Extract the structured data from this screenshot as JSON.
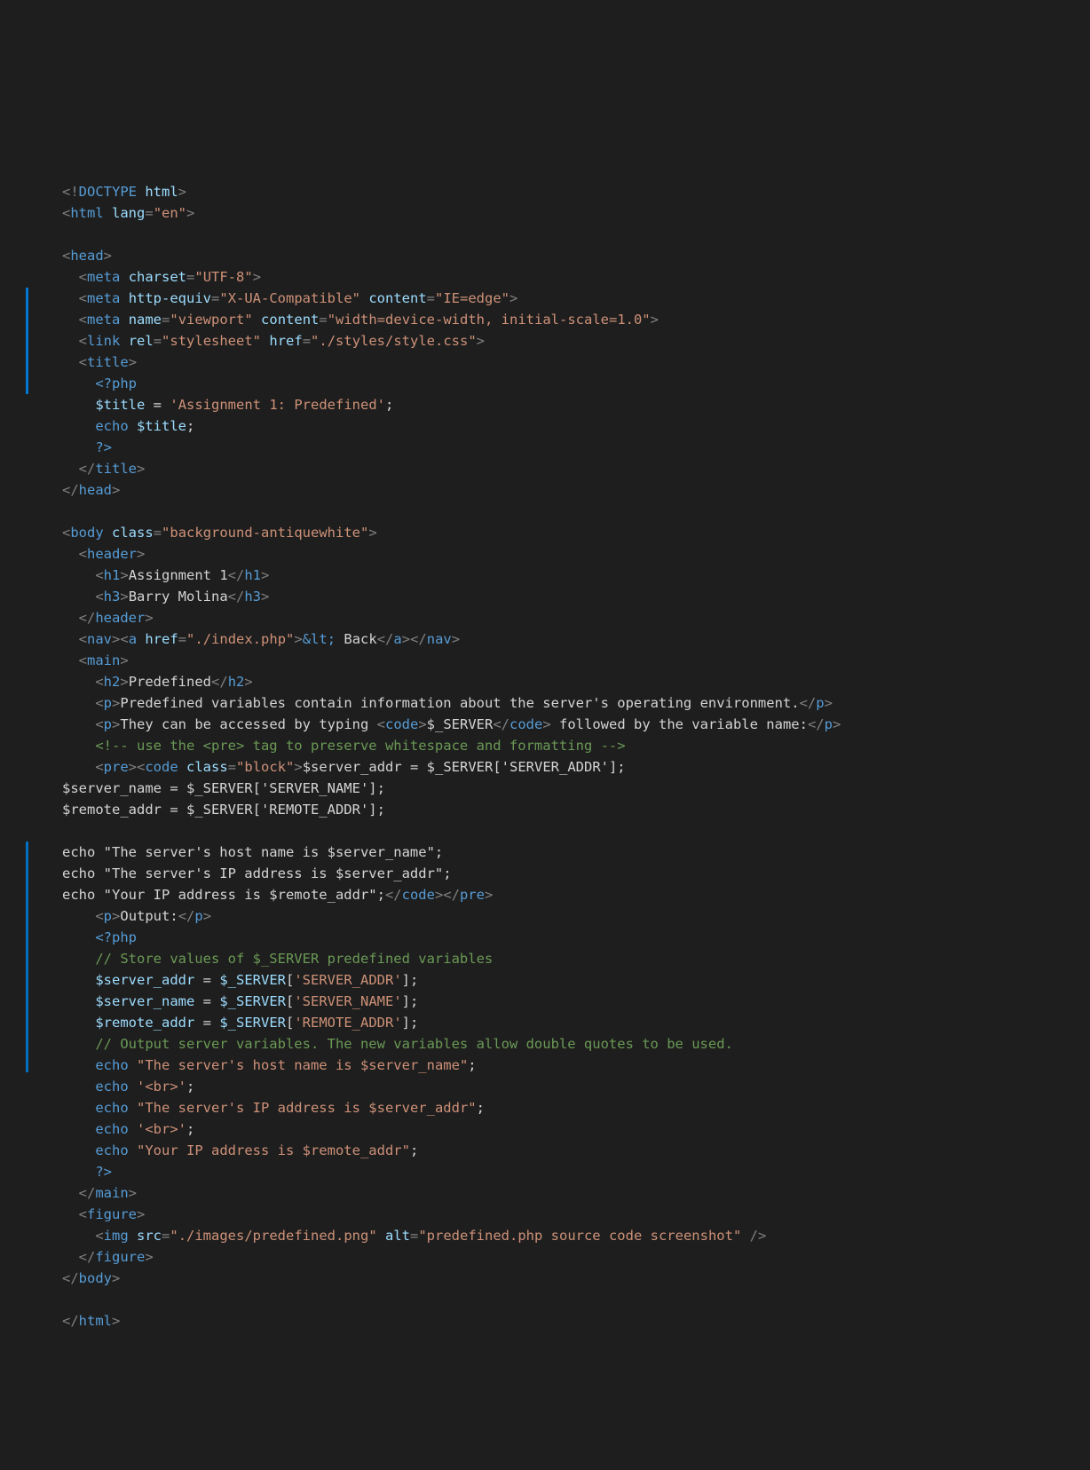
{
  "lines": [
    [
      [
        "pun",
        "<!"
      ],
      [
        "tag",
        "DOCTYPE"
      ],
      [
        "txt",
        " "
      ],
      [
        "attr",
        "html"
      ],
      [
        "pun",
        ">"
      ]
    ],
    [
      [
        "pun",
        "<"
      ],
      [
        "tag",
        "html"
      ],
      [
        "txt",
        " "
      ],
      [
        "attr",
        "lang"
      ],
      [
        "pun",
        "="
      ],
      [
        "str",
        "\"en\""
      ],
      [
        "pun",
        ">"
      ]
    ],
    [],
    [
      [
        "pun",
        "<"
      ],
      [
        "tag",
        "head"
      ],
      [
        "pun",
        ">"
      ]
    ],
    [
      [
        "txt",
        "  "
      ],
      [
        "pun",
        "<"
      ],
      [
        "tag",
        "meta"
      ],
      [
        "txt",
        " "
      ],
      [
        "attr",
        "charset"
      ],
      [
        "pun",
        "="
      ],
      [
        "str",
        "\"UTF-8\""
      ],
      [
        "pun",
        ">"
      ]
    ],
    [
      [
        "txt",
        "  "
      ],
      [
        "pun",
        "<"
      ],
      [
        "tag",
        "meta"
      ],
      [
        "txt",
        " "
      ],
      [
        "attr",
        "http-equiv"
      ],
      [
        "pun",
        "="
      ],
      [
        "str",
        "\"X-UA-Compatible\""
      ],
      [
        "txt",
        " "
      ],
      [
        "attr",
        "content"
      ],
      [
        "pun",
        "="
      ],
      [
        "str",
        "\"IE=edge\""
      ],
      [
        "pun",
        ">"
      ]
    ],
    [
      [
        "txt",
        "  "
      ],
      [
        "pun",
        "<"
      ],
      [
        "tag",
        "meta"
      ],
      [
        "txt",
        " "
      ],
      [
        "attr",
        "name"
      ],
      [
        "pun",
        "="
      ],
      [
        "str",
        "\"viewport\""
      ],
      [
        "txt",
        " "
      ],
      [
        "attr",
        "content"
      ],
      [
        "pun",
        "="
      ],
      [
        "str",
        "\"width=device-width, initial-scale=1.0\""
      ],
      [
        "pun",
        ">"
      ]
    ],
    [
      [
        "txt",
        "  "
      ],
      [
        "pun",
        "<"
      ],
      [
        "tag",
        "link"
      ],
      [
        "txt",
        " "
      ],
      [
        "attr",
        "rel"
      ],
      [
        "pun",
        "="
      ],
      [
        "str",
        "\"stylesheet\""
      ],
      [
        "txt",
        " "
      ],
      [
        "attr",
        "href"
      ],
      [
        "pun",
        "="
      ],
      [
        "str",
        "\"./styles/style.css\""
      ],
      [
        "pun",
        ">"
      ]
    ],
    [
      [
        "txt",
        "  "
      ],
      [
        "pun",
        "<"
      ],
      [
        "tag",
        "title"
      ],
      [
        "pun",
        ">"
      ]
    ],
    [
      [
        "txt",
        "    "
      ],
      [
        "php",
        "<?php"
      ]
    ],
    [
      [
        "txt",
        "    "
      ],
      [
        "var",
        "$title"
      ],
      [
        "txt",
        " "
      ],
      [
        "op",
        "="
      ],
      [
        "txt",
        " "
      ],
      [
        "str",
        "'Assignment 1: Predefined'"
      ],
      [
        "txt",
        ";"
      ]
    ],
    [
      [
        "txt",
        "    "
      ],
      [
        "kw",
        "echo"
      ],
      [
        "txt",
        " "
      ],
      [
        "var",
        "$title"
      ],
      [
        "txt",
        ";"
      ]
    ],
    [
      [
        "txt",
        "    "
      ],
      [
        "php",
        "?>"
      ]
    ],
    [
      [
        "txt",
        "  "
      ],
      [
        "pun",
        "</"
      ],
      [
        "tag",
        "title"
      ],
      [
        "pun",
        ">"
      ]
    ],
    [
      [
        "pun",
        "</"
      ],
      [
        "tag",
        "head"
      ],
      [
        "pun",
        ">"
      ]
    ],
    [],
    [
      [
        "pun",
        "<"
      ],
      [
        "tag",
        "body"
      ],
      [
        "txt",
        " "
      ],
      [
        "attr",
        "class"
      ],
      [
        "pun",
        "="
      ],
      [
        "str",
        "\"background-antiquewhite\""
      ],
      [
        "pun",
        ">"
      ]
    ],
    [
      [
        "txt",
        "  "
      ],
      [
        "pun",
        "<"
      ],
      [
        "tag",
        "header"
      ],
      [
        "pun",
        ">"
      ]
    ],
    [
      [
        "txt",
        "    "
      ],
      [
        "pun",
        "<"
      ],
      [
        "tag",
        "h1"
      ],
      [
        "pun",
        ">"
      ],
      [
        "txt",
        "Assignment 1"
      ],
      [
        "pun",
        "</"
      ],
      [
        "tag",
        "h1"
      ],
      [
        "pun",
        ">"
      ]
    ],
    [
      [
        "txt",
        "    "
      ],
      [
        "pun",
        "<"
      ],
      [
        "tag",
        "h3"
      ],
      [
        "pun",
        ">"
      ],
      [
        "txt",
        "Barry Molina"
      ],
      [
        "pun",
        "</"
      ],
      [
        "tag",
        "h3"
      ],
      [
        "pun",
        ">"
      ]
    ],
    [
      [
        "txt",
        "  "
      ],
      [
        "pun",
        "</"
      ],
      [
        "tag",
        "header"
      ],
      [
        "pun",
        ">"
      ]
    ],
    [
      [
        "txt",
        "  "
      ],
      [
        "pun",
        "<"
      ],
      [
        "tag",
        "nav"
      ],
      [
        "pun",
        "><"
      ],
      [
        "tag",
        "a"
      ],
      [
        "txt",
        " "
      ],
      [
        "attr",
        "href"
      ],
      [
        "pun",
        "="
      ],
      [
        "str",
        "\"./index.php\""
      ],
      [
        "pun",
        ">"
      ],
      [
        "tag",
        "&lt;"
      ],
      [
        "txt",
        " Back"
      ],
      [
        "pun",
        "</"
      ],
      [
        "tag",
        "a"
      ],
      [
        "pun",
        "></"
      ],
      [
        "tag",
        "nav"
      ],
      [
        "pun",
        ">"
      ]
    ],
    [
      [
        "txt",
        "  "
      ],
      [
        "pun",
        "<"
      ],
      [
        "tag",
        "main"
      ],
      [
        "pun",
        ">"
      ]
    ],
    [
      [
        "txt",
        "    "
      ],
      [
        "pun",
        "<"
      ],
      [
        "tag",
        "h2"
      ],
      [
        "pun",
        ">"
      ],
      [
        "txt",
        "Predefined"
      ],
      [
        "pun",
        "</"
      ],
      [
        "tag",
        "h2"
      ],
      [
        "pun",
        ">"
      ]
    ],
    [
      [
        "txt",
        "    "
      ],
      [
        "pun",
        "<"
      ],
      [
        "tag",
        "p"
      ],
      [
        "pun",
        ">"
      ],
      [
        "txt",
        "Predefined variables contain information about the server's operating environment."
      ],
      [
        "pun",
        "</"
      ],
      [
        "tag",
        "p"
      ],
      [
        "pun",
        ">"
      ]
    ],
    [
      [
        "txt",
        "    "
      ],
      [
        "pun",
        "<"
      ],
      [
        "tag",
        "p"
      ],
      [
        "pun",
        ">"
      ],
      [
        "txt",
        "They can be accessed by typing "
      ],
      [
        "pun",
        "<"
      ],
      [
        "tag",
        "code"
      ],
      [
        "pun",
        ">"
      ],
      [
        "txt",
        "$_SERVER"
      ],
      [
        "pun",
        "</"
      ],
      [
        "tag",
        "code"
      ],
      [
        "pun",
        ">"
      ],
      [
        "txt",
        " followed by the variable name:"
      ],
      [
        "pun",
        "</"
      ],
      [
        "tag",
        "p"
      ],
      [
        "pun",
        ">"
      ]
    ],
    [
      [
        "txt",
        "    "
      ],
      [
        "cmt",
        "<!-- use the <pre> tag to preserve whitespace and formatting -->"
      ]
    ],
    [
      [
        "txt",
        "    "
      ],
      [
        "pun",
        "<"
      ],
      [
        "tag",
        "pre"
      ],
      [
        "pun",
        "><"
      ],
      [
        "tag",
        "code"
      ],
      [
        "txt",
        " "
      ],
      [
        "attr",
        "class"
      ],
      [
        "pun",
        "="
      ],
      [
        "str",
        "\"block\""
      ],
      [
        "pun",
        ">"
      ],
      [
        "txt",
        "$server_addr = $_SERVER['SERVER_ADDR'];"
      ]
    ],
    [
      [
        "txt",
        "$server_name = $_SERVER['SERVER_NAME'];"
      ]
    ],
    [
      [
        "txt",
        "$remote_addr = $_SERVER['REMOTE_ADDR'];"
      ]
    ],
    [],
    [
      [
        "txt",
        "echo \"The server's host name is $server_name\";"
      ]
    ],
    [
      [
        "txt",
        "echo \"The server's IP address is $server_addr\";"
      ]
    ],
    [
      [
        "txt",
        "echo \"Your IP address is $remote_addr\";"
      ],
      [
        "pun",
        "</"
      ],
      [
        "tag",
        "code"
      ],
      [
        "pun",
        "></"
      ],
      [
        "tag",
        "pre"
      ],
      [
        "pun",
        ">"
      ]
    ],
    [
      [
        "txt",
        "    "
      ],
      [
        "pun",
        "<"
      ],
      [
        "tag",
        "p"
      ],
      [
        "pun",
        ">"
      ],
      [
        "txt",
        "Output:"
      ],
      [
        "pun",
        "</"
      ],
      [
        "tag",
        "p"
      ],
      [
        "pun",
        ">"
      ]
    ],
    [
      [
        "txt",
        "    "
      ],
      [
        "php",
        "<?php"
      ]
    ],
    [
      [
        "txt",
        "    "
      ],
      [
        "cmt",
        "// Store values of $_SERVER predefined variables"
      ]
    ],
    [
      [
        "txt",
        "    "
      ],
      [
        "var",
        "$server_addr"
      ],
      [
        "txt",
        " "
      ],
      [
        "op",
        "="
      ],
      [
        "txt",
        " "
      ],
      [
        "var",
        "$_SERVER"
      ],
      [
        "txt",
        "["
      ],
      [
        "str",
        "'SERVER_ADDR'"
      ],
      [
        "txt",
        "];"
      ]
    ],
    [
      [
        "txt",
        "    "
      ],
      [
        "var",
        "$server_name"
      ],
      [
        "txt",
        " "
      ],
      [
        "op",
        "="
      ],
      [
        "txt",
        " "
      ],
      [
        "var",
        "$_SERVER"
      ],
      [
        "txt",
        "["
      ],
      [
        "str",
        "'SERVER_NAME'"
      ],
      [
        "txt",
        "];"
      ]
    ],
    [
      [
        "txt",
        "    "
      ],
      [
        "var",
        "$remote_addr"
      ],
      [
        "txt",
        " "
      ],
      [
        "op",
        "="
      ],
      [
        "txt",
        " "
      ],
      [
        "var",
        "$_SERVER"
      ],
      [
        "txt",
        "["
      ],
      [
        "str",
        "'REMOTE_ADDR'"
      ],
      [
        "txt",
        "];"
      ]
    ],
    [
      [
        "txt",
        "    "
      ],
      [
        "cmt",
        "// Output server variables. The new variables allow double quotes to be used."
      ]
    ],
    [
      [
        "txt",
        "    "
      ],
      [
        "kw",
        "echo"
      ],
      [
        "txt",
        " "
      ],
      [
        "str",
        "\"The server's host name is $server_name\""
      ],
      [
        "txt",
        ";"
      ]
    ],
    [
      [
        "txt",
        "    "
      ],
      [
        "kw",
        "echo"
      ],
      [
        "txt",
        " "
      ],
      [
        "str",
        "'<br>'"
      ],
      [
        "txt",
        ";"
      ]
    ],
    [
      [
        "txt",
        "    "
      ],
      [
        "kw",
        "echo"
      ],
      [
        "txt",
        " "
      ],
      [
        "str",
        "\"The server's IP address is $server_addr\""
      ],
      [
        "txt",
        ";"
      ]
    ],
    [
      [
        "txt",
        "    "
      ],
      [
        "kw",
        "echo"
      ],
      [
        "txt",
        " "
      ],
      [
        "str",
        "'<br>'"
      ],
      [
        "txt",
        ";"
      ]
    ],
    [
      [
        "txt",
        "    "
      ],
      [
        "kw",
        "echo"
      ],
      [
        "txt",
        " "
      ],
      [
        "str",
        "\"Your IP address is $remote_addr\""
      ],
      [
        "txt",
        ";"
      ]
    ],
    [
      [
        "txt",
        "    "
      ],
      [
        "php",
        "?>"
      ]
    ],
    [
      [
        "txt",
        "  "
      ],
      [
        "pun",
        "</"
      ],
      [
        "tag",
        "main"
      ],
      [
        "pun",
        ">"
      ]
    ],
    [
      [
        "txt",
        "  "
      ],
      [
        "pun",
        "<"
      ],
      [
        "tag",
        "figure"
      ],
      [
        "pun",
        ">"
      ]
    ],
    [
      [
        "txt",
        "    "
      ],
      [
        "pun",
        "<"
      ],
      [
        "tag",
        "img"
      ],
      [
        "txt",
        " "
      ],
      [
        "attr",
        "src"
      ],
      [
        "pun",
        "="
      ],
      [
        "str",
        "\"./images/predefined.png\""
      ],
      [
        "txt",
        " "
      ],
      [
        "attr",
        "alt"
      ],
      [
        "pun",
        "="
      ],
      [
        "str",
        "\"predefined.php source code screenshot\""
      ],
      [
        "txt",
        " "
      ],
      [
        "pun",
        "/>"
      ]
    ],
    [
      [
        "txt",
        "  "
      ],
      [
        "pun",
        "</"
      ],
      [
        "tag",
        "figure"
      ],
      [
        "pun",
        ">"
      ]
    ],
    [
      [
        "pun",
        "</"
      ],
      [
        "tag",
        "body"
      ],
      [
        "pun",
        ">"
      ]
    ],
    [],
    [
      [
        "pun",
        "</"
      ],
      [
        "tag",
        "html"
      ],
      [
        "pun",
        ">"
      ]
    ]
  ]
}
